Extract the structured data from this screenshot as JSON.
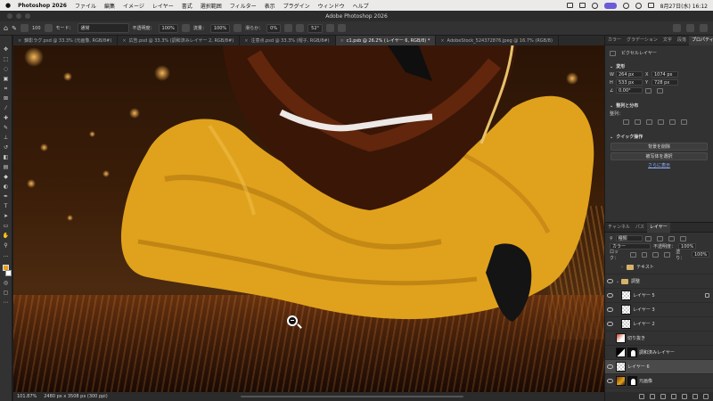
{
  "menubar": {
    "app": "Photoshop 2026",
    "items": [
      "ファイル",
      "編集",
      "イメージ",
      "レイヤー",
      "書式",
      "選択範囲",
      "フィルター",
      "表示",
      "プラグイン",
      "ウィンドウ",
      "ヘルプ"
    ],
    "clock": "8月27日(水) 16:12"
  },
  "window": {
    "title": "Adobe Photoshop 2026"
  },
  "options": {
    "size": "100",
    "mode_label": "モード：",
    "mode_value": "通常",
    "opacity_label": "不透明度：",
    "opacity_value": "100%",
    "flow_label": "流量：",
    "flow_value": "100%",
    "smooth_label": "滑らか：",
    "smooth_value": "0%",
    "angle_value": "52°"
  },
  "tabs": [
    {
      "label": "錦影ラグ.psd @ 33.3% (元画像, RGB/8#)",
      "active": false
    },
    {
      "label": "広告.psd @ 33.3% (調和済みレイヤー 2, RGB/8#)",
      "active": false
    },
    {
      "label": "注意点.psd @ 33.3% (帽子, RGB/8#)",
      "active": false
    },
    {
      "label": "c1.psb @ 26.2% (レイヤー 6, RGB/8) *",
      "active": true
    },
    {
      "label": "AdobeStock_524372876.jpeg @ 16.7% (RGB/8)",
      "active": false
    }
  ],
  "status": {
    "zoom": "101.87%",
    "doc": "2480 px x 3508 px (300 ppi)"
  },
  "props": {
    "tabs": [
      "カラー",
      "グラデーション",
      "文字",
      "段落",
      "プロパティ"
    ],
    "layer_type": "ピクセルレイヤー",
    "transform_title": "変形",
    "w": "264 px",
    "x": "1074 px",
    "h": "533 px",
    "y": "728 px",
    "angle": "0.00°",
    "align_title": "整列と分布",
    "align_label": "整列：",
    "quick_title": "クイック操作",
    "btn_remove_bg": "背景を削除",
    "btn_select_subject": "被写体を選択",
    "more_link": "さらに表示"
  },
  "layers": {
    "tabs": [
      "チャンネル",
      "パス",
      "レイヤー"
    ],
    "filter_kind": "種類",
    "blend": "カラー",
    "opacity_label": "不透明度：",
    "opacity_value": "100%",
    "lock_label": "ロック：",
    "fill_label": "塗り：",
    "fill_value": "100%",
    "items": [
      {
        "name": "テキスト",
        "kind": "folder",
        "visible": false,
        "indent": 1
      },
      {
        "name": "調整",
        "kind": "folder-open",
        "visible": true,
        "indent": 0
      },
      {
        "name": "レイヤー 5",
        "kind": "pixel",
        "visible": true,
        "indent": 1,
        "locked": true
      },
      {
        "name": "レイヤー 3",
        "kind": "pixel",
        "visible": true,
        "indent": 1
      },
      {
        "name": "レイヤー 2",
        "kind": "pixel",
        "visible": true,
        "indent": 1
      },
      {
        "name": "切り抜き",
        "kind": "red",
        "visible": false,
        "indent": 0
      },
      {
        "name": "調和済みレイヤー",
        "kind": "adj-mask",
        "visible": false,
        "indent": 0
      },
      {
        "name": "レイヤー 6",
        "kind": "pixel",
        "visible": true,
        "indent": 0,
        "selected": true
      },
      {
        "name": "元画像",
        "kind": "img-mask",
        "visible": true,
        "indent": 0
      }
    ]
  }
}
